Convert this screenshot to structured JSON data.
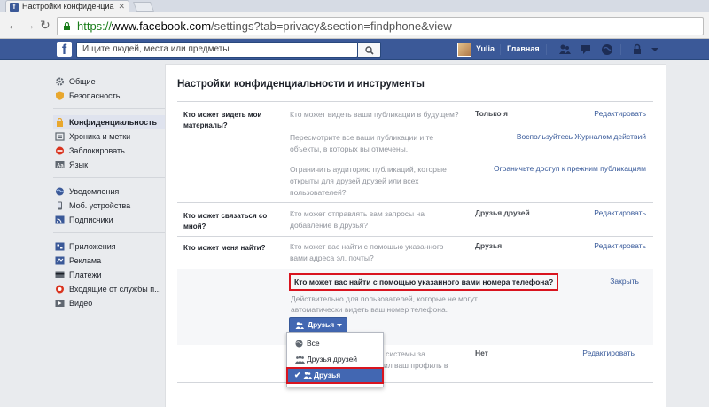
{
  "browser": {
    "tab_title": "Настройки конфиденциа",
    "url_scheme": "https://",
    "url_host": "www.facebook.com",
    "url_path": "/settings?tab=privacy&section=findphone&view"
  },
  "topbar": {
    "search_placeholder": "Ищите людей, места или предметы",
    "user_name": "Yulia",
    "home_label": "Главная",
    "brand_color": "#3b5998"
  },
  "sidebar": {
    "groups": [
      [
        {
          "label": "Общие",
          "icon": "gear-icon"
        },
        {
          "label": "Безопасность",
          "icon": "shield-icon"
        }
      ],
      [
        {
          "label": "Конфиденциальность",
          "icon": "lock-icon",
          "active": true
        },
        {
          "label": "Хроника и метки",
          "icon": "timeline-icon"
        },
        {
          "label": "Заблокировать",
          "icon": "block-icon"
        },
        {
          "label": "Язык",
          "icon": "language-icon"
        }
      ],
      [
        {
          "label": "Уведомления",
          "icon": "globe-icon"
        },
        {
          "label": "Моб. устройства",
          "icon": "mobile-icon"
        },
        {
          "label": "Подписчики",
          "icon": "rss-icon"
        }
      ],
      [
        {
          "label": "Приложения",
          "icon": "apps-icon"
        },
        {
          "label": "Реклама",
          "icon": "ads-icon"
        },
        {
          "label": "Платежи",
          "icon": "payments-icon"
        },
        {
          "label": "Входящие от службы п...",
          "icon": "support-icon"
        },
        {
          "label": "Видео",
          "icon": "video-icon"
        }
      ]
    ]
  },
  "main": {
    "title": "Настройки конфиденциальности и инструменты",
    "sections": [
      {
        "title": "Кто может видеть мои материалы?",
        "rows": [
          {
            "question": "Кто может видеть ваши публикации в будущем?",
            "value": "Только я",
            "action": "Редактировать"
          },
          {
            "question": "Пересмотрите все ваши публикации и те объекты, в которых вы отмечены.",
            "value": "",
            "action": "Воспользуйтесь Журналом действий"
          },
          {
            "question": "Ограничить аудиторию публикаций, которые открыты для друзей друзей или всех пользователей?",
            "value": "",
            "action": "Ограничьте доступ к прежним публикациям"
          }
        ]
      },
      {
        "title": "Кто может связаться со мной?",
        "rows": [
          {
            "question": "Кто может отправлять вам запросы на добавление в друзья?",
            "value": "Друзья друзей",
            "action": "Редактировать"
          }
        ]
      },
      {
        "title": "Кто может меня найти?",
        "rows": [
          {
            "question": "Кто может вас найти с помощью указанного вами адреса эл. почты?",
            "value": "Друзья",
            "action": "Редактировать"
          },
          {
            "question": "...е системы за ...ил ваш профиль в",
            "value": "Нет",
            "action": "Редактировать"
          }
        ]
      }
    ],
    "expanded": {
      "question": "Кто может вас найти с помощью указанного вами номера телефона?",
      "close_label": "Закрыть",
      "description": "Действительно для пользователей, которые не могут автоматически видеть ваш номер телефона.",
      "audience_button": "Друзья"
    },
    "dropdown": {
      "options": [
        {
          "label": "Все",
          "icon": "globe-icon",
          "selected": false
        },
        {
          "label": "Друзья друзей",
          "icon": "friends-of-friends-icon",
          "selected": false
        },
        {
          "label": "Друзья",
          "icon": "friends-icon",
          "selected": true
        }
      ],
      "highlight_color": "#d9141f"
    }
  }
}
